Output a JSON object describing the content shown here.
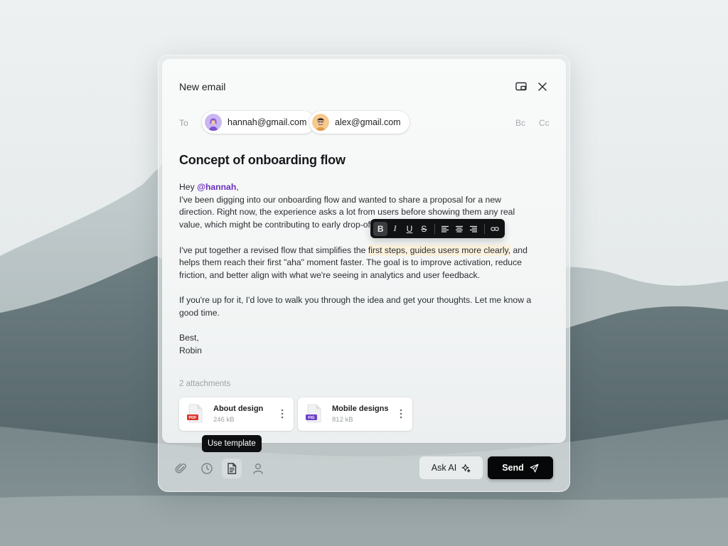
{
  "compose": {
    "title": "New email",
    "to_label": "To",
    "recipients": [
      {
        "email": "hannah@gmail.com",
        "avatar": "avatar-hannah"
      },
      {
        "email": "alex@gmail.com",
        "avatar": "avatar-alex"
      }
    ],
    "bc_label": "Bc",
    "cc_label": "Cc",
    "subject": "Concept of onboarding flow",
    "body": {
      "greeting_prefix": "Hey ",
      "mention": "@hannah",
      "greeting_suffix": ",",
      "p1": "I've been digging into our onboarding flow and wanted to share a proposal for a new direction. Right now, the experience asks a lot from users before showing them any real value, which might be contributing to early drop-offs.",
      "p2_before": "I've put together a revised flow that simplifies the ",
      "p2_highlight": "first steps, guides users more clearly,",
      "p2_after": " and helps them reach their first \"aha\" moment faster. The goal is to improve activation, reduce friction, and better align with what we're seeing in analytics and user feedback.",
      "p3": "If you're up for it, I'd love to walk you through the idea and get your thoughts. Let me know a good time.",
      "signoff": "Best,",
      "signature": "Robin"
    },
    "format_toolbar": {
      "bold_label": "B",
      "italic_label": "I",
      "underline_label": "U",
      "strike_label": "S",
      "active": "bold"
    },
    "attachments_label": "2 attachments",
    "attachments": [
      {
        "name": "About design",
        "size": "246 kB",
        "type_badge": "PDF",
        "badge_color": "#d9342b"
      },
      {
        "name": "Mobile designs",
        "size": "812 kB",
        "type_badge": "FIG",
        "badge_color": "#6b3fc9"
      }
    ],
    "tooltip": "Use template",
    "bottom_tools": [
      "paperclip-icon",
      "clock-icon",
      "template-icon",
      "person-icon"
    ],
    "ask_ai_label": "Ask AI",
    "send_label": "Send"
  }
}
